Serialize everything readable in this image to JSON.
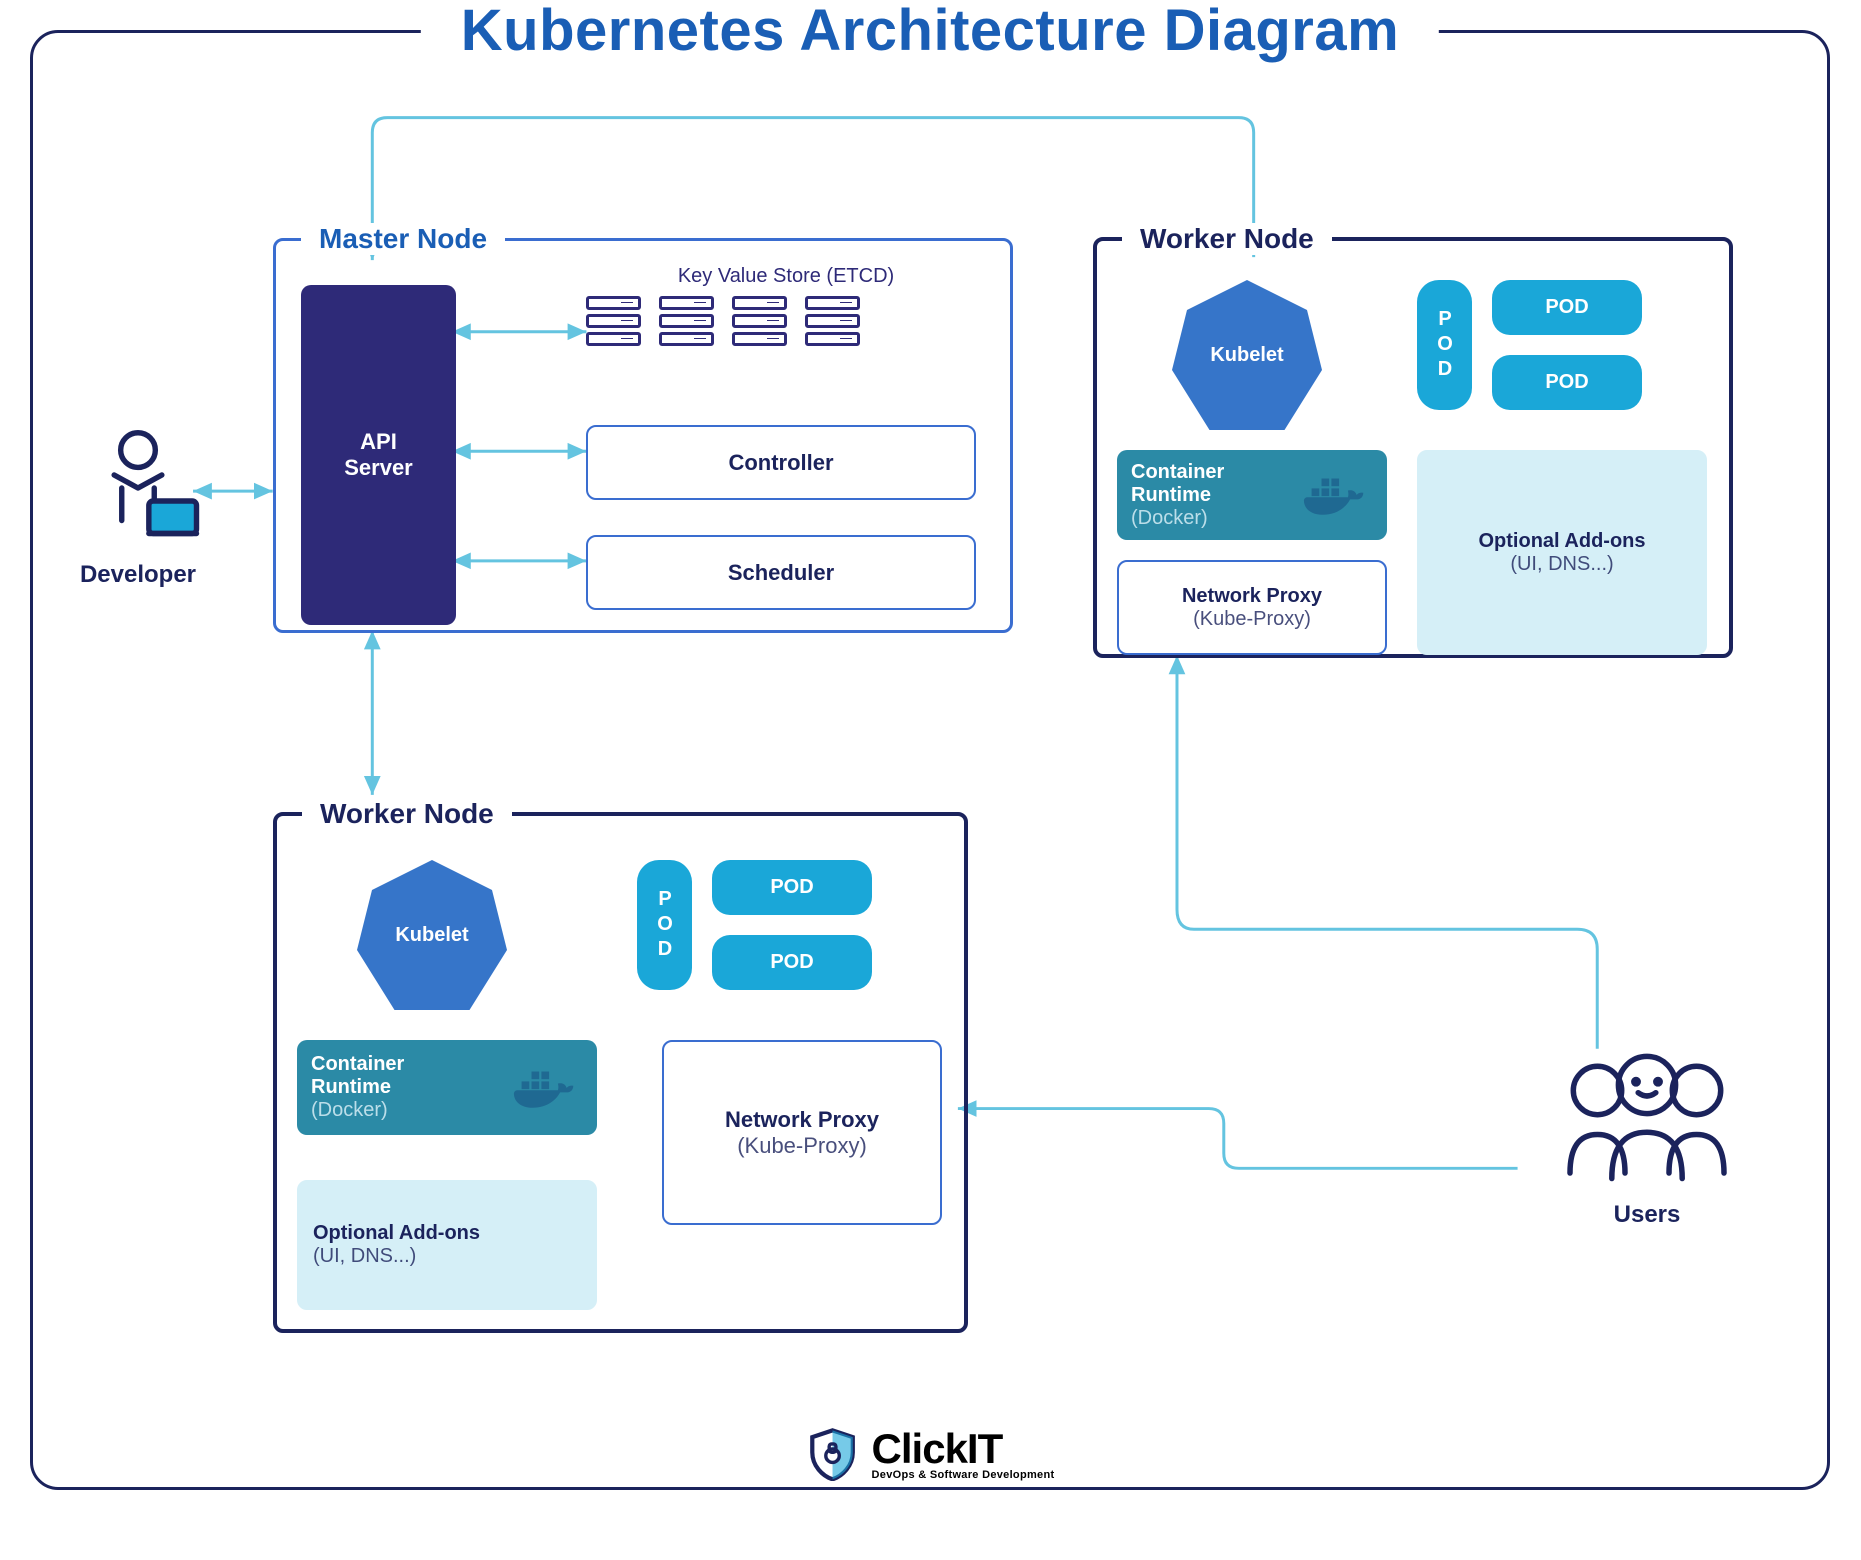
{
  "title": "Kubernetes Architecture Diagram",
  "actors": {
    "developer": "Developer",
    "users": "Users"
  },
  "master": {
    "title": "Master Node",
    "api_server": "API\nServer",
    "etcd_label": "Key Value Store (ETCD)",
    "controller": "Controller",
    "scheduler": "Scheduler"
  },
  "worker": {
    "title": "Worker Node",
    "kubelet": "Kubelet",
    "runtime_title": "Container\nRuntime",
    "runtime_sub": "(Docker)",
    "net_proxy_title": "Network Proxy",
    "net_proxy_sub": "(Kube-Proxy)",
    "addons_title": "Optional Add-ons",
    "addons_sub": "(UI, DNS...)",
    "pod": "POD"
  },
  "brand": {
    "name": "ClickIT",
    "tagline": "DevOps & Software Development"
  },
  "colors": {
    "navy": "#1b235c",
    "blue": "#1a5eb5",
    "cyan": "#1aa7d8",
    "teal": "#2b8aa6",
    "purple": "#2e2a78",
    "ice": "#d5eff7"
  },
  "edges": [
    {
      "from": "developer",
      "to": "master.api_server",
      "dir": "both"
    },
    {
      "from": "master.api_server",
      "to": "master.etcd",
      "dir": "both"
    },
    {
      "from": "master.api_server",
      "to": "master.controller",
      "dir": "both"
    },
    {
      "from": "master.api_server",
      "to": "master.scheduler",
      "dir": "both"
    },
    {
      "from": "master.api_server",
      "to": "worker_right.kubelet",
      "dir": "both"
    },
    {
      "from": "master.api_server",
      "to": "worker_bottom.kubelet",
      "dir": "both"
    },
    {
      "from": "users",
      "to": "worker_right.network_proxy",
      "dir": "to"
    },
    {
      "from": "users",
      "to": "worker_bottom.network_proxy",
      "dir": "to"
    }
  ]
}
